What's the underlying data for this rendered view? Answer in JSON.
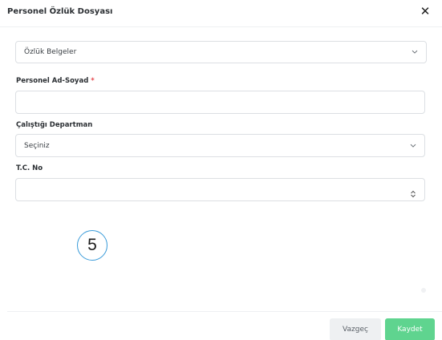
{
  "modal": {
    "title": "Personel Özlük Dosyası"
  },
  "category_select": {
    "value": "Özlük Belgeler"
  },
  "name_field": {
    "label": "Personel Ad-Soyad",
    "required_mark": "*",
    "value": ""
  },
  "department_field": {
    "label": "Çalıştığı Departman",
    "value": "Seçiniz"
  },
  "tc_field": {
    "label": "T.C. No",
    "value": ""
  },
  "step_marker": "5",
  "footer": {
    "cancel_label": "Vazgeç",
    "save_label": "Kaydet"
  },
  "colors": {
    "save_button": "#5fd48f",
    "step_circle": "#3a9bd9",
    "required": "#e5484d"
  }
}
